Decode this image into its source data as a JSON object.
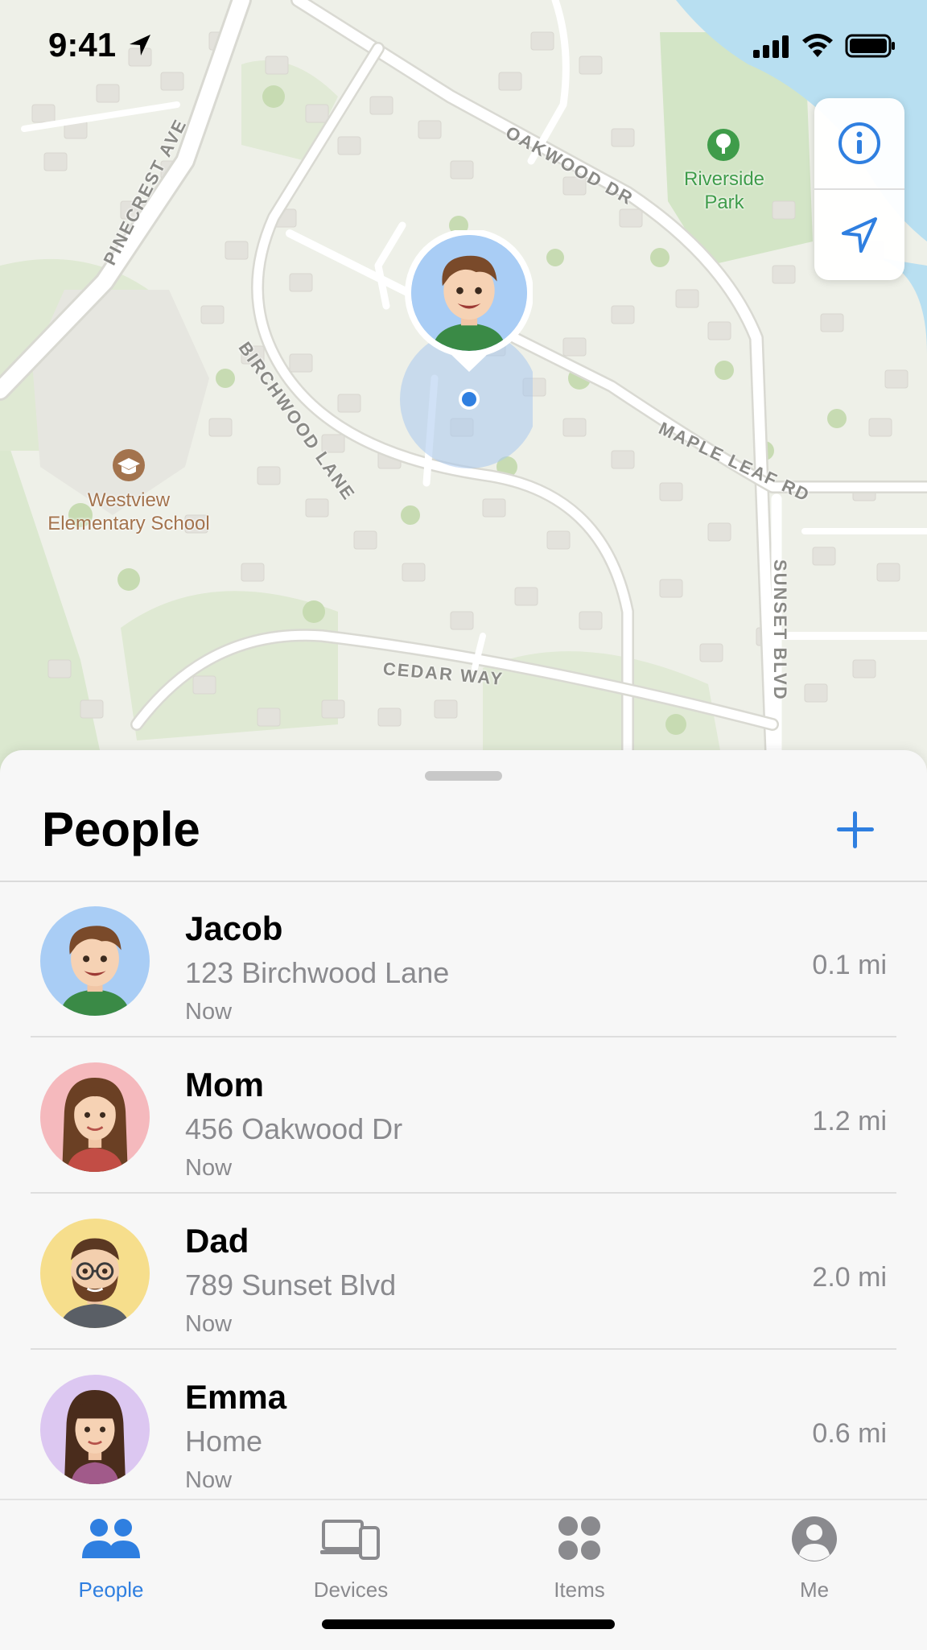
{
  "status_bar": {
    "time": "9:41"
  },
  "map": {
    "streets": [
      {
        "id": "pinecrest",
        "name": "PINECREST AVE"
      },
      {
        "id": "oakwood",
        "name": "OAKWOOD DR"
      },
      {
        "id": "birchwood",
        "name": "BIRCHWOOD LANE"
      },
      {
        "id": "maple",
        "name": "MAPLE LEAF RD"
      },
      {
        "id": "sunset",
        "name": "SUNSET BLVD"
      },
      {
        "id": "cedar",
        "name": "CEDAR WAY"
      }
    ],
    "pois": {
      "park": {
        "name": "Riverside Park",
        "line1": "Riverside",
        "line2": "Park",
        "icon": "tree-icon"
      },
      "school": {
        "name": "Westview Elementary School",
        "line1": "Westview",
        "line2": "Elementary School",
        "icon": "graduation-cap-icon"
      }
    },
    "controls": [
      {
        "id": "info",
        "icon": "info-icon"
      },
      {
        "id": "locate",
        "icon": "location-arrow-icon"
      }
    ]
  },
  "sheet": {
    "title": "People",
    "add_icon": "plus-icon",
    "people": [
      {
        "name": "Jacob",
        "address": "123 Birchwood Lane",
        "time": "Now",
        "distance": "0.1 mi",
        "avatar_bg": "#a9cdf5"
      },
      {
        "name": "Mom",
        "address": "456 Oakwood Dr",
        "time": "Now",
        "distance": "1.2 mi",
        "avatar_bg": "#f5b9bd"
      },
      {
        "name": "Dad",
        "address": "789 Sunset Blvd",
        "time": "Now",
        "distance": "2.0 mi",
        "avatar_bg": "#f6de8c"
      },
      {
        "name": "Emma",
        "address": "Home",
        "time": "Now",
        "distance": "0.6 mi",
        "avatar_bg": "#dcc7f1"
      }
    ]
  },
  "tabbar": {
    "tabs": [
      {
        "id": "people",
        "label": "People",
        "icon": "people-icon",
        "active": true
      },
      {
        "id": "devices",
        "label": "Devices",
        "icon": "devices-icon",
        "active": false
      },
      {
        "id": "items",
        "label": "Items",
        "icon": "items-icon",
        "active": false
      },
      {
        "id": "me",
        "label": "Me",
        "icon": "person-circle-icon",
        "active": false
      }
    ]
  },
  "colors": {
    "accent": "#2f7fe0",
    "inactive": "#8a8a8e",
    "park_green": "#3f9c4a",
    "school_brown": "#a3734d"
  }
}
